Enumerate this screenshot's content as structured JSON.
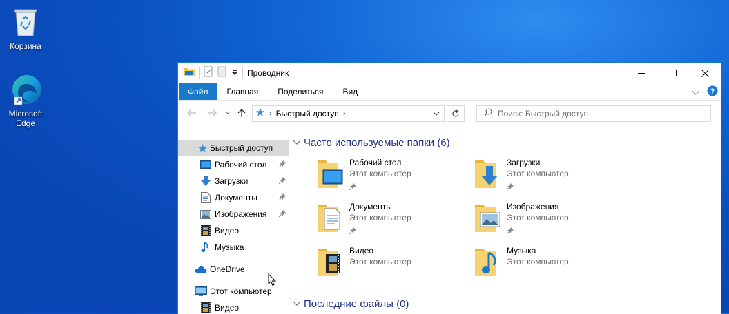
{
  "desktop": {
    "icons": [
      {
        "label": "Корзина",
        "icon": "recycle-bin-icon"
      },
      {
        "label": "Microsoft Edge",
        "label_line1": "Microsoft",
        "label_line2": "Edge",
        "icon": "edge-icon"
      }
    ]
  },
  "window": {
    "title": "Проводник",
    "ribbon_tabs": [
      "Файл",
      "Главная",
      "Поделиться",
      "Вид"
    ],
    "address": {
      "crumb": "Быстрый доступ"
    },
    "search": {
      "placeholder": "Поиск: Быстрый доступ"
    }
  },
  "nav_pane": {
    "items": [
      {
        "label": "Быстрый доступ",
        "icon": "star-icon",
        "selected": true
      },
      {
        "label": "Рабочий стол",
        "icon": "desktop-icon",
        "pinned": true
      },
      {
        "label": "Загрузки",
        "icon": "download-icon",
        "pinned": true
      },
      {
        "label": "Документы",
        "icon": "documents-icon",
        "pinned": true
      },
      {
        "label": "Изображения",
        "icon": "pictures-icon",
        "pinned": true
      },
      {
        "label": "Видео",
        "icon": "video-icon"
      },
      {
        "label": "Музыка",
        "icon": "music-icon"
      },
      {
        "label": "OneDrive",
        "icon": "cloud-icon"
      },
      {
        "label": "Этот компьютер",
        "icon": "computer-icon"
      },
      {
        "label": "Видео",
        "icon": "video-icon"
      }
    ]
  },
  "content": {
    "frequent_header": "Часто используемые папки (6)",
    "recent_header": "Последние файлы (0)",
    "folders": [
      {
        "name": "Рабочий стол",
        "location": "Этот компьютер",
        "pinned": true
      },
      {
        "name": "Загрузки",
        "location": "Этот компьютер",
        "pinned": true
      },
      {
        "name": "Документы",
        "location": "Этот компьютер",
        "pinned": true
      },
      {
        "name": "Изображения",
        "location": "Этот компьютер",
        "pinned": true
      },
      {
        "name": "Видео",
        "location": "Этот компьютер",
        "pinned": false
      },
      {
        "name": "Музыка",
        "location": "Этот компьютер",
        "pinned": false
      }
    ]
  },
  "colors": {
    "accent": "#1979ca",
    "folder": "#f3c84a",
    "group_header": "#1e3287"
  }
}
